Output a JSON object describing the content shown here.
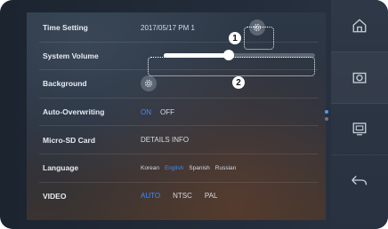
{
  "settings": {
    "time_setting": {
      "label": "Time Setting",
      "value": "2017/05/17  PM 1"
    },
    "system_volume": {
      "label": "System Volume",
      "level_percent": 43
    },
    "background": {
      "label": "Background"
    },
    "auto_overwriting": {
      "label": "Auto-Overwriting",
      "on": "ON",
      "off": "OFF",
      "selected": "ON"
    },
    "micro_sd": {
      "label": "Micro-SD Card",
      "value": "DETAILS INFO"
    },
    "language": {
      "label": "Language",
      "options": [
        "Korean",
        "English",
        "Spanish",
        "Russian"
      ],
      "selected": "English"
    },
    "video": {
      "label": "VIDEO",
      "options": [
        "AUTO",
        "NTSC",
        "PAL"
      ],
      "selected": "AUTO"
    }
  },
  "callouts": {
    "one": "1",
    "two": "2"
  },
  "sidebar": {
    "buttons": [
      {
        "icon": "home-icon"
      },
      {
        "icon": "camera-icon"
      },
      {
        "icon": "monitor-icon"
      },
      {
        "icon": "back-icon"
      }
    ]
  },
  "colors": {
    "accent": "#3a8cff",
    "text": "#e8ecf2"
  }
}
